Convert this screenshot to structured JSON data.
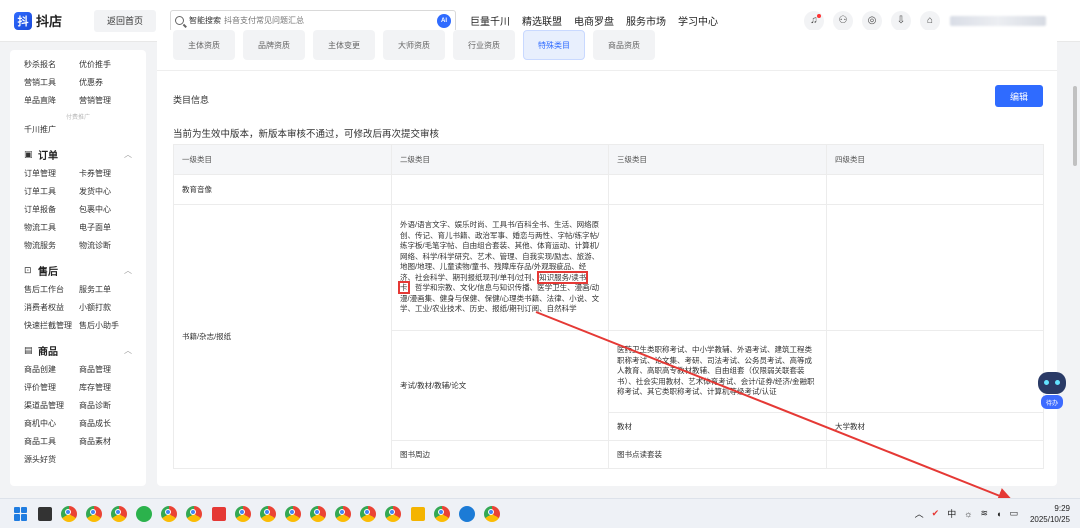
{
  "app": {
    "name": "抖店",
    "logo_glyph": "抖"
  },
  "topbar": {
    "back_label": "返回首页",
    "search_prefix": "智能搜索",
    "search_placeholder": "抖音支付常见问题汇总",
    "ai_label": "AI",
    "nav": [
      "巨量千川",
      "精选联盟",
      "电商罗盘",
      "服务市场",
      "学习中心"
    ]
  },
  "sidebar": {
    "top_links": [
      "秒杀报名",
      "优价推手",
      "营销工具",
      "优惠券",
      "单品直降",
      "营销管理"
    ],
    "ad_divider": "付费推广",
    "ad_link": "千川推广",
    "sections": [
      {
        "title": "订单",
        "icon": "▣",
        "links": [
          "订单管理",
          "卡券管理",
          "订单工具",
          "发货中心",
          "订单报备",
          "包裹中心",
          "物流工具",
          "电子面单",
          "物流服务",
          "物流诊断"
        ]
      },
      {
        "title": "售后",
        "icon": "⊡",
        "links": [
          "售后工作台",
          "服务工单",
          "消费者权益",
          "小额打款",
          "快速拦截管理",
          "售后小助手"
        ]
      },
      {
        "title": "商品",
        "icon": "▤",
        "links": [
          "商品创建",
          "商品管理",
          "评价管理",
          "库存管理",
          "渠道品管理",
          "商品诊断",
          "商机中心",
          "商品成长",
          "商品工具",
          "商品素材",
          "源头好货"
        ]
      }
    ]
  },
  "tabs": [
    "主体资质",
    "品牌资质",
    "主体变更",
    "大师资质",
    "行业资质",
    "特殊类目",
    "商品资质"
  ],
  "active_tab": 5,
  "main": {
    "section_title": "类目信息",
    "edit_label": "编辑",
    "notice": "当前为生效中版本，新版本审核不通过，可修改后再次提交审核",
    "table": {
      "headers": [
        "一级类目",
        "二级类目",
        "三级类目",
        "四级类目"
      ],
      "level1_a": "教育音像",
      "level1_b": "书籍/杂志/报纸",
      "row2_level2_before": "外语/语言文字、娱乐时尚、工具书/百科全书、生活、网络原创、传记、育儿书籍、政治军事、婚恋与两性、字帖/练字帖/练字板/毛笔字帖、自由组合套装、其他、体育运动、计算机/网络、科学/科学研究、艺术、管理、自我实现/励志、旅游、地图/地理、儿童读物/童书、残障库存品/外观瑕疵品、经济、社会科学、期刊报纸现刊/单刊/过刊、",
      "row2_level2_highlight": "知识服务/读书卡",
      "row2_level2_after": "、哲学和宗教、文化/信息与知识传播、医学卫生、漫画/动漫/漫画集、健身与保健、保健/心理类书籍、法律、小说、文学、工业/农业技术、历史、报纸/期刊订阅、自然科学",
      "row3_level2": "考试/教材/教辅/论文",
      "row3_level3": "医药卫生类职称考试、中小学教辅、外语考试、建筑工程类职称考试、论文集、考研、司法考试、公务员考试、高等成人教育、高职高专教材教辅、自由组套（仅限弱关联套装书）、社会实用教材、艺术体育考试、会计/证券/经济/金融职称考试、其它类职称考试、计算机等级考试/认证",
      "row4_level3": "教材",
      "row4_level4": "大学教材",
      "row5_level2": "图书周边",
      "row5_level3": "图书点读套装"
    }
  },
  "assistant": {
    "label": "待办"
  },
  "taskbar": {
    "ime": "中",
    "time": "9:29",
    "date": "2025/10/25"
  }
}
